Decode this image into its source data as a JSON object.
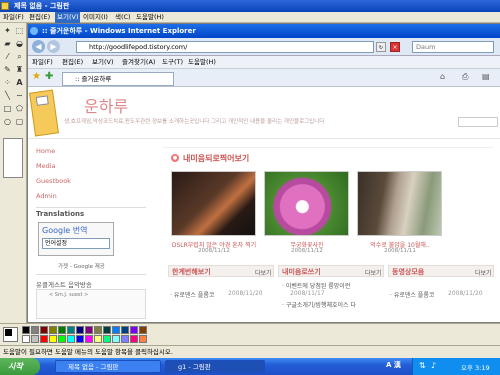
{
  "paint": {
    "title": "제목 없음 - 그림판",
    "menu": [
      "파일(F)",
      "편집(E)",
      "보기(V)",
      "이미지(I)",
      "색(C)",
      "도움말(H)"
    ],
    "status": "도움말이 필요하면 도움말 메뉴의 도움말 항목을 클릭하십시오."
  },
  "palette_colors": [
    "#000000",
    "#808080",
    "#800000",
    "#808000",
    "#008000",
    "#008080",
    "#000080",
    "#800080",
    "#808040",
    "#004040",
    "#0080ff",
    "#004080",
    "#8000ff",
    "#804000",
    "#ffffff",
    "#c0c0c0",
    "#ff0000",
    "#ffff00",
    "#00ff00",
    "#00ffff",
    "#0000ff",
    "#ff00ff",
    "#ffff80",
    "#00ff80",
    "#80ffff",
    "#8080ff",
    "#ff0080",
    "#ff8040"
  ],
  "ie": {
    "title": ":: 즐거운하루 - Windows Internet Explorer",
    "address": "http://goodlifepod.tistory.com/",
    "search_placeholder": "Daum",
    "menu": [
      "파일(F)",
      "편집(E)",
      "보기(V)",
      "즐겨찾기(A)",
      "도구(T)",
      "도움말(H)"
    ],
    "tab_title": ":: 즐거운하루"
  },
  "blog": {
    "name": "운하루",
    "desc": "생,호프게임,악성코드치료,윈도우관련 정보를 소개하는곳입니다 그리고 개인적인 내용을 올리는 개인블로그입니다",
    "nav": [
      "Home",
      "Media",
      "Guestbook",
      "Admin"
    ],
    "translations_title": "Translations",
    "google_label": "Google 번역",
    "lang_select": "언어설정",
    "google_footer": "가젯 - Google 제공",
    "music_label": "유클게스트 음악방송",
    "music_track": "< Sm.J. suest >",
    "sec_photos": "내미음되로찍어보기",
    "photos": [
      {
        "cap": "DSLR부럽지 않은 야경 혼자 찍기",
        "date": "2008/11/12"
      },
      {
        "cap": "무궁화꽃사진",
        "date": "2008/11/12"
      },
      {
        "cap": "억수로 불암을 10월해..",
        "date": "2008/11/11"
      }
    ],
    "boxes": [
      {
        "title": "한계번해보기",
        "more": "다보기",
        "items": [
          {
            "t": "· 유로덴스 플롬코",
            "d": "2008/11/20"
          }
        ]
      },
      {
        "title": "내미음로쓰기",
        "more": "다보기",
        "items": [
          {
            "t": "· 이벤트에 당첨된 룸망이런",
            "d": "2008/11/17"
          },
          {
            "t": "· 구글소개기/빙행체호이스 다",
            "d": ""
          }
        ]
      },
      {
        "title": "동영상모음",
        "more": "다보기",
        "items": [
          {
            "t": "· 유로덴스 플롬코",
            "d": "2008/11/20"
          }
        ]
      }
    ]
  },
  "taskbar": {
    "start": "시작",
    "tasks": [
      "제목 없음 - 그림판",
      "g1 - 그림판"
    ],
    "ime": "A 漢",
    "clock": "오후 3:19"
  }
}
